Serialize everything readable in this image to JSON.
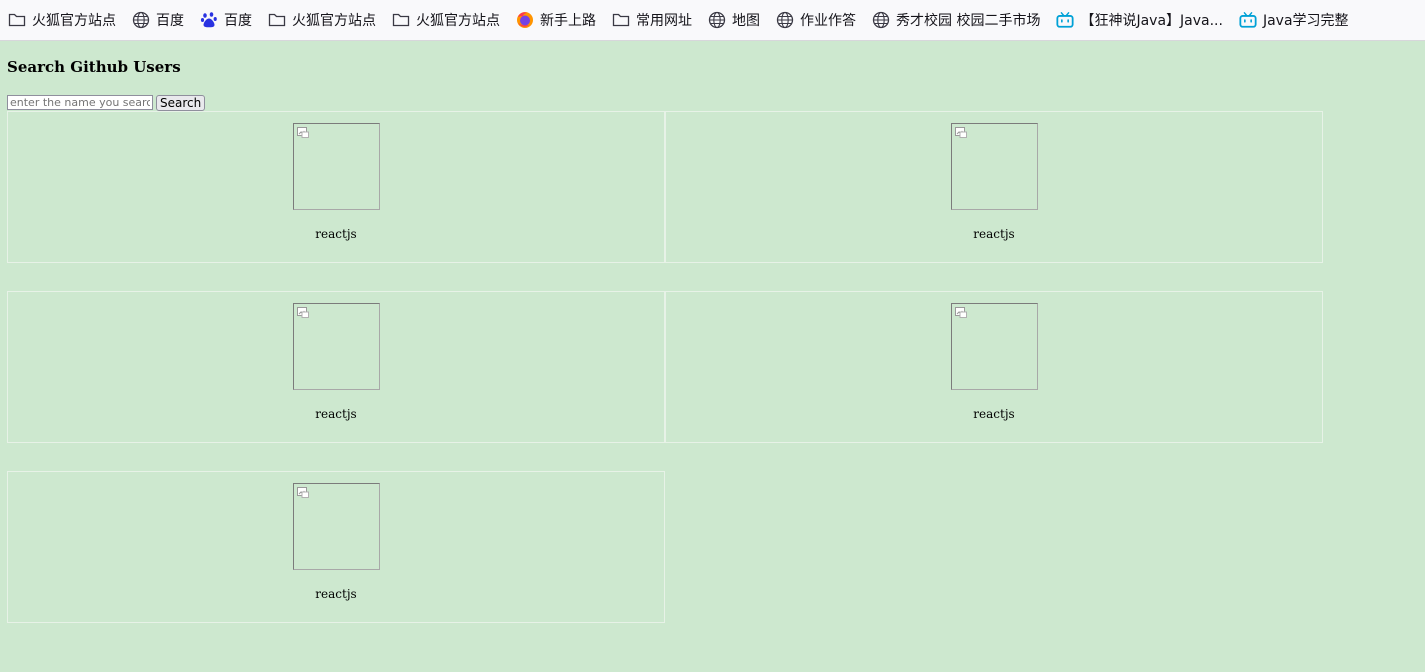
{
  "bookmarks": [
    {
      "label": "火狐官方站点",
      "icon": "folder-icon"
    },
    {
      "label": "百度",
      "icon": "globe-icon"
    },
    {
      "label": "百度",
      "icon": "baidu-paw-icon"
    },
    {
      "label": "火狐官方站点",
      "icon": "folder-icon"
    },
    {
      "label": "火狐官方站点",
      "icon": "folder-icon"
    },
    {
      "label": "新手上路",
      "icon": "firefox-icon"
    },
    {
      "label": "常用网址",
      "icon": "folder-icon"
    },
    {
      "label": "地图",
      "icon": "globe-icon"
    },
    {
      "label": "作业作答",
      "icon": "globe-icon"
    },
    {
      "label": "秀才校园 校园二手市场",
      "icon": "globe-icon"
    },
    {
      "label": "【狂神说Java】Java...",
      "icon": "bilibili-icon"
    },
    {
      "label": "Java学习完整",
      "icon": "bilibili-icon"
    }
  ],
  "page": {
    "title": "Search Github Users",
    "search": {
      "placeholder": "enter the name you search",
      "value": "",
      "button_label": "Search"
    }
  },
  "users": [
    {
      "login": "reactjs"
    },
    {
      "login": "reactjs"
    },
    {
      "login": "reactjs"
    },
    {
      "login": "reactjs"
    },
    {
      "login": "reactjs"
    }
  ],
  "colors": {
    "page_background": "#cde8cf",
    "toolbar_background": "#f9f9fb",
    "bilibili": "#00a1d6",
    "baidu": "#2932e1"
  }
}
